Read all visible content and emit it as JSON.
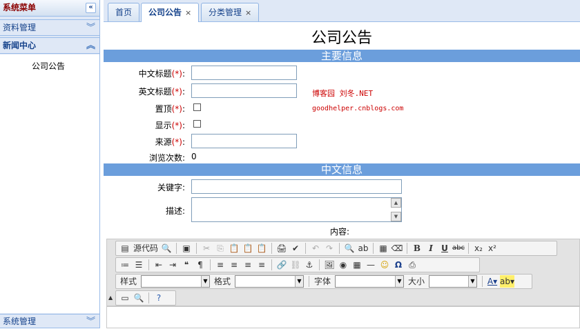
{
  "sidebar": {
    "menu_title": "系统菜单",
    "collapse_btn": "«",
    "items": [
      {
        "label": "资料管理",
        "chevron": "︾"
      },
      {
        "label": "新闻中心",
        "chevron": "︽"
      }
    ],
    "sub_item": "公司公告",
    "bottom_item": {
      "label": "系统管理",
      "chevron": "︾"
    }
  },
  "tabs": [
    {
      "label": "首页",
      "close": ""
    },
    {
      "label": "公司公告",
      "close": "×"
    },
    {
      "label": "分类管理",
      "close": "×"
    }
  ],
  "page": {
    "title": "公司公告",
    "section_main": "主要信息",
    "section_cn": "中文信息",
    "fields": {
      "cn_title": {
        "label": "中文标题",
        "req": "(*)",
        "colon": ":"
      },
      "en_title": {
        "label": "英文标题",
        "req": "(*)",
        "colon": ":"
      },
      "top": {
        "label": "置顶",
        "req": "(*)",
        "colon": ":"
      },
      "show": {
        "label": "显示",
        "req": "(*)",
        "colon": ":"
      },
      "source": {
        "label": "来源",
        "req": "(*)",
        "colon": ":"
      },
      "views": {
        "label": "浏览次数:",
        "value": "0"
      },
      "keywords": {
        "label": "关键字:"
      },
      "description": {
        "label": "描述:"
      },
      "content": {
        "label": "内容:"
      }
    },
    "ad_line1": "博客园 刘冬.NET",
    "ad_line2": "goodhelper.cnblogs.com"
  },
  "editor": {
    "source_btn": "源代码",
    "style_label": "样式",
    "format_label": "格式",
    "font_label": "字体",
    "size_label": "大小",
    "buttons_row1": [
      "✂",
      "⎘",
      "📋",
      "📋",
      "📋",
      "🖨",
      "✔",
      "↶",
      "↷",
      "🔍",
      "ab",
      "▦",
      "⌫",
      "B",
      "I",
      "U",
      "abc",
      "x₂",
      "x²"
    ],
    "buttons_row2": [
      "≔",
      "☰",
      "⇤",
      "⇥",
      "❝",
      "¶",
      "≡",
      "≡",
      "≡",
      "≡",
      "🔗",
      "⛓",
      "⚓",
      "🖼",
      "◉",
      "▦",
      "—",
      "☺",
      "Ω",
      "⎙"
    ]
  }
}
